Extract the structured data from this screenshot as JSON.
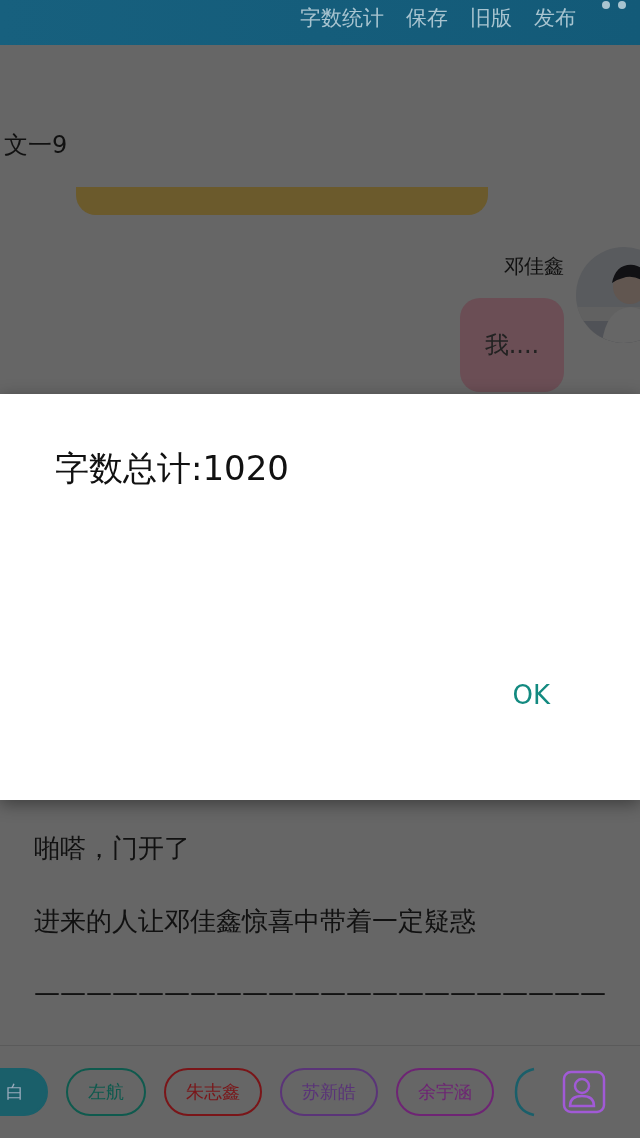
{
  "toolbar": {
    "actions": [
      "字数统计",
      "保存",
      "旧版",
      "发布"
    ]
  },
  "story": {
    "heading": "文一9",
    "speaker": {
      "name": "邓佳鑫",
      "message": "我...."
    },
    "paragraphs": [
      "啪嗒，门开了",
      "进来的人让邓佳鑫惊喜中带着一定疑惑",
      "——————————————————————"
    ]
  },
  "character_bar": [
    {
      "label": "白",
      "color": "#1a5f6a",
      "selected": true
    },
    {
      "label": "左航",
      "color": "#0f5a4e",
      "selected": false
    },
    {
      "label": "朱志鑫",
      "color": "#7a1518",
      "selected": false
    },
    {
      "label": "苏新皓",
      "color": "#5a3478",
      "selected": false
    },
    {
      "label": "余宇涵",
      "color": "#6e2474",
      "selected": false
    }
  ],
  "dialog": {
    "message": "字数总计:1020",
    "button": "OK"
  }
}
